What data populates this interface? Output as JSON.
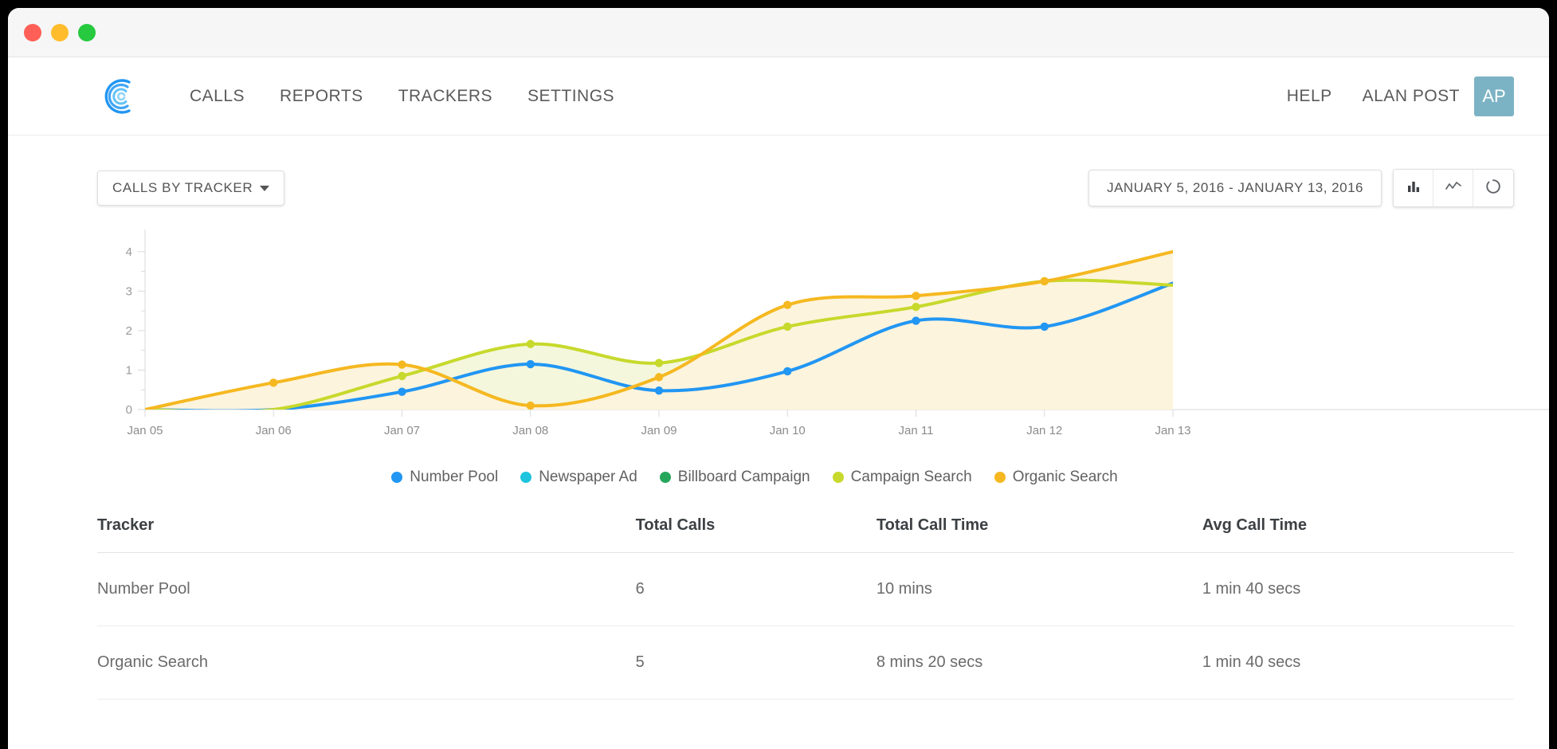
{
  "window": {
    "traffic_lights": [
      {
        "name": "close",
        "color": "#ff5f56"
      },
      {
        "name": "minimize",
        "color": "#ffbd2e"
      },
      {
        "name": "maximize",
        "color": "#27c93f"
      }
    ]
  },
  "nav": {
    "logo_name": "callrail-logo",
    "links": [
      {
        "label": "CALLS"
      },
      {
        "label": "REPORTS"
      },
      {
        "label": "TRACKERS"
      },
      {
        "label": "SETTINGS"
      }
    ],
    "help_label": "HELP",
    "user_name": "ALAN POST",
    "avatar_initials": "AP",
    "avatar_color": "#7cb3c4"
  },
  "toolbar": {
    "report_select_label": "CALLS BY TRACKER",
    "date_range_label": "JANUARY 5, 2016 - JANUARY 13, 2016",
    "view_buttons": [
      {
        "icon": "bar-chart-icon",
        "active": true
      },
      {
        "icon": "line-chart-icon",
        "active": false
      },
      {
        "icon": "donut-chart-icon",
        "active": false
      }
    ]
  },
  "chart_data": {
    "type": "area",
    "title": "",
    "xlabel": "",
    "ylabel": "",
    "ylim": [
      0,
      4.4
    ],
    "yticks": [
      0,
      1,
      2,
      3,
      4
    ],
    "ytick_labels": [
      "0",
      "1",
      "2",
      "3",
      "4"
    ],
    "grid": false,
    "legend_position": "bottom",
    "categories": [
      "Jan 05",
      "Jan 06",
      "Jan 07",
      "Jan 08",
      "Jan 09",
      "Jan 10",
      "Jan 11",
      "Jan 12",
      "Jan 13"
    ],
    "series": [
      {
        "name": "Number Pool",
        "color": "#2196f3",
        "fill": "#dbe9f7",
        "values": [
          0,
          0,
          0.45,
          1.15,
          0.48,
          0.97,
          2.25,
          2.1,
          3.2
        ]
      },
      {
        "name": "Newspaper Ad",
        "color": "#1ec4dd",
        "fill": "#d8f3f7",
        "values": [
          0,
          0,
          0,
          0,
          0,
          0,
          0,
          0,
          0
        ]
      },
      {
        "name": "Billboard Campaign",
        "color": "#26a65b",
        "fill": "#dcf0e5",
        "values": [
          0,
          0,
          0,
          0,
          0,
          0,
          0,
          0,
          0
        ]
      },
      {
        "name": "Campaign Search",
        "color": "#c7d92c",
        "fill": "#f4f7dc",
        "values": [
          0,
          0,
          0.85,
          1.66,
          1.18,
          2.1,
          2.6,
          3.25,
          3.15
        ]
      },
      {
        "name": "Organic Search",
        "color": "#f5b820",
        "fill": "#fdf4dd",
        "values": [
          0,
          0.68,
          1.14,
          0.1,
          0.82,
          2.65,
          2.88,
          3.25,
          4.0
        ]
      }
    ]
  },
  "table": {
    "columns": [
      "Tracker",
      "Total Calls",
      "Total Call Time",
      "Avg Call Time"
    ],
    "rows": [
      {
        "tracker": "Number Pool",
        "total_calls": "6",
        "total_call_time": "10 mins",
        "avg_call_time": "1 min 40 secs"
      },
      {
        "tracker": "Organic Search",
        "total_calls": "5",
        "total_call_time": "8 mins 20 secs",
        "avg_call_time": "1 min 40 secs"
      }
    ]
  }
}
